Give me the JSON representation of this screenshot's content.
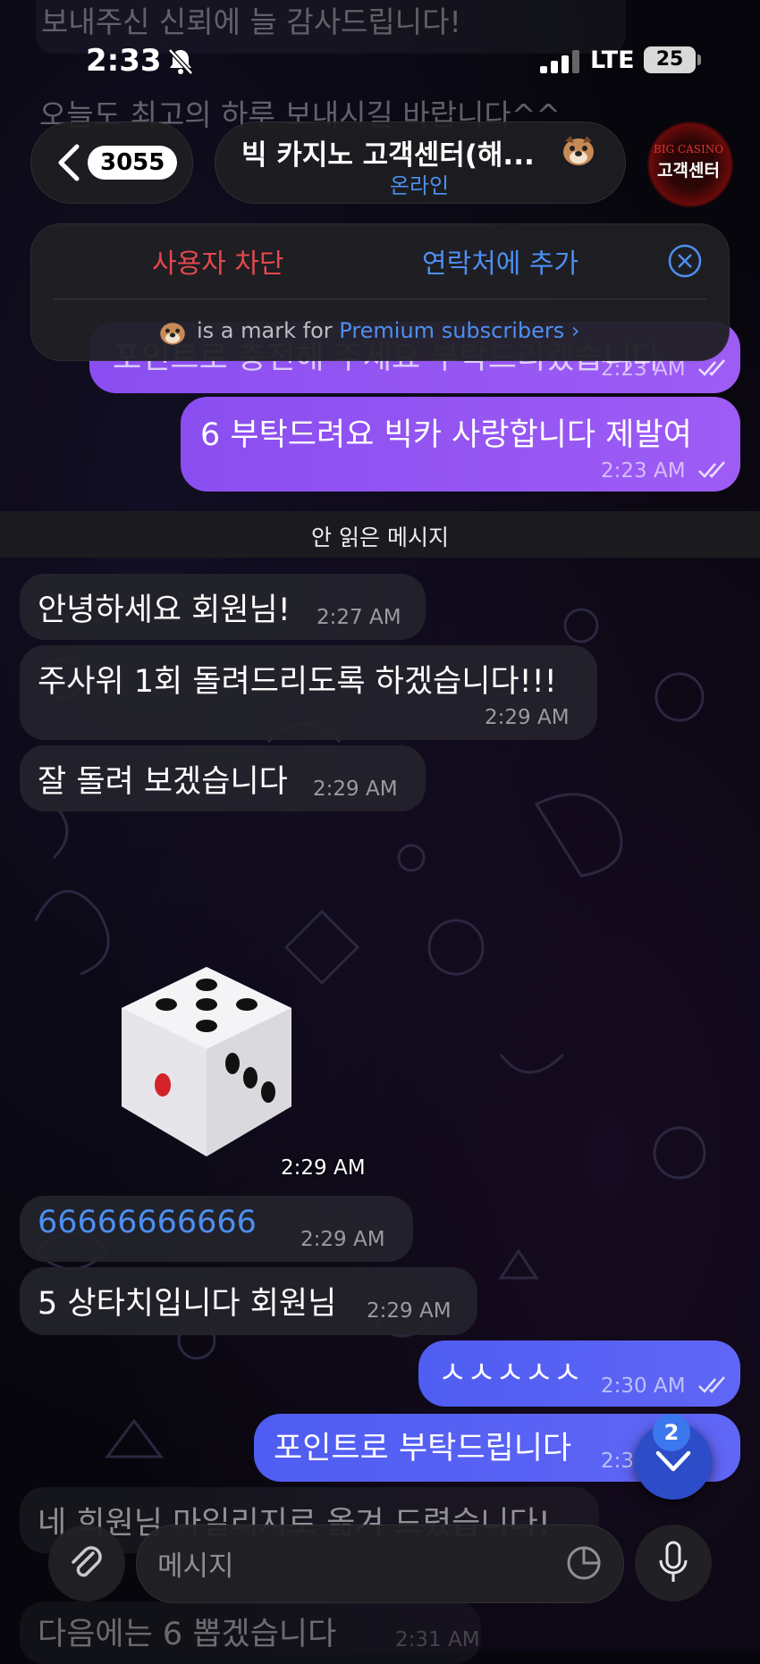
{
  "status_bar": {
    "time": "2:33",
    "network": "LTE",
    "battery": "25"
  },
  "header": {
    "back_count": "3055",
    "title": "빅 카지노 고객센터(해...",
    "status": "온라인",
    "avatar_brand": "BIG CASINO",
    "avatar_label": "고객센터"
  },
  "action_panel": {
    "block": "사용자 차단",
    "add_contact": "연락처에 추가",
    "premium_prefix": "is a mark for",
    "premium_link": "Premium subscribers ›"
  },
  "top_faded": {
    "line1": "보내주신 신뢰에 늘 감사드립니다!",
    "line2": "오늘도 최고의 하루 보내시길 바랍니다^^"
  },
  "messages": [
    {
      "text": "포인트로 충전해 주세요 부탁드리겠습니다",
      "time": "2:23 AM"
    },
    {
      "text": "6 부탁드려요 빅카 사랑합니다 제발여",
      "time": "2:23 AM"
    },
    {
      "text": "안녕하세요 회원님!",
      "time": "2:27 AM"
    },
    {
      "text": "주사위 1회 돌려드리도록 하겠습니다!!!",
      "time": "2:29 AM"
    },
    {
      "text": "잘 돌려 보겠습니다",
      "time": "2:29 AM"
    },
    {
      "time": "2:29 AM"
    },
    {
      "text": "66666666666",
      "time": "2:29 AM"
    },
    {
      "text": "5 상타치입니다 회원님",
      "time": "2:29 AM"
    },
    {
      "text": "ㅅㅅㅅㅅㅅ",
      "time": "2:30 AM"
    },
    {
      "text": "포인트로 부탁드립니다",
      "time": "2:30 AM"
    },
    {
      "text": "네 회원님 마일리지로 옮겨 드렸습니다!",
      "time": ""
    },
    {
      "text": "다음에는 6 뽑겠습니다",
      "time": "2:31 AM"
    }
  ],
  "unread_divider": "안 읽은 메시지",
  "scroll_down_badge": "2",
  "composer": {
    "placeholder": "메시지"
  },
  "colors": {
    "outgoing_purple": "#9a58f4",
    "outgoing_blue": "#5560f3",
    "incoming": "#24242c",
    "accent": "#4d8ff0",
    "danger": "#e5484d"
  }
}
